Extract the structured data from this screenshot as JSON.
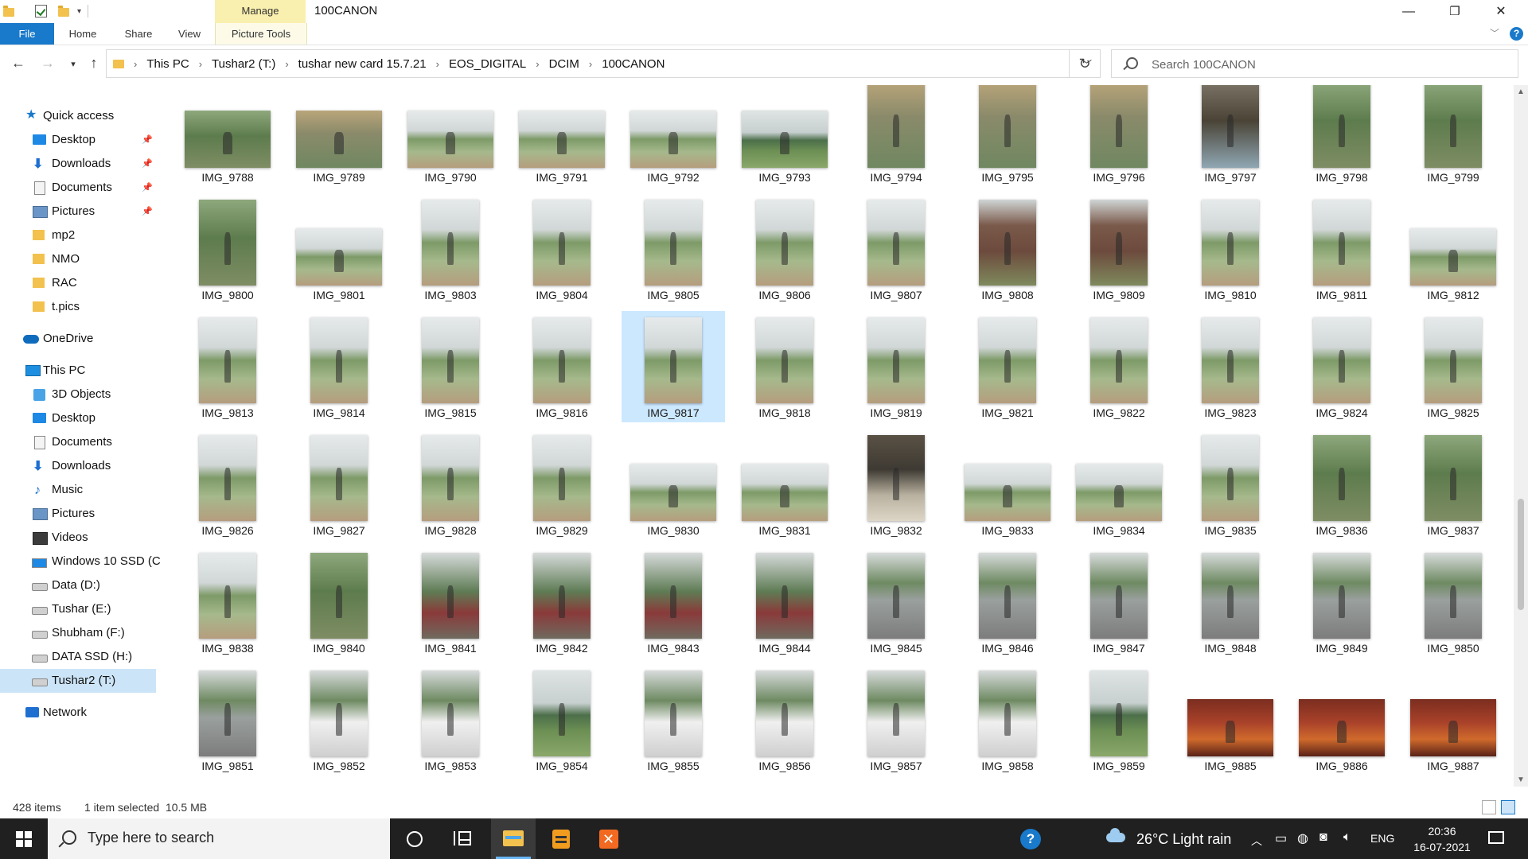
{
  "window": {
    "title": "100CANON",
    "manage_tab": "Manage",
    "picture_tools_tab": "Picture Tools",
    "minimize": "—",
    "maximize": "❐",
    "close": "✕"
  },
  "ribbon": {
    "tabs": [
      "File",
      "Home",
      "Share",
      "View"
    ],
    "help": "?"
  },
  "address": {
    "crumbs": [
      "This PC",
      "Tushar2 (T:)",
      "tushar new card 15.7.21",
      "EOS_DIGITAL",
      "DCIM",
      "100CANON"
    ],
    "search_placeholder": "Search 100CANON"
  },
  "nav": {
    "quick_access": "Quick access",
    "quick_items": [
      "Desktop",
      "Downloads",
      "Documents",
      "Pictures",
      "mp2",
      "NMO",
      "RAC",
      "t.pics"
    ],
    "onedrive": "OneDrive",
    "this_pc": "This PC",
    "pc_items": [
      "3D Objects",
      "Desktop",
      "Documents",
      "Downloads",
      "Music",
      "Pictures",
      "Videos",
      "Windows 10 SSD (C",
      "Data (D:)",
      "Tushar (E:)",
      "Shubham (F:)",
      "DATA SSD (H:)",
      "Tushar2 (T:)"
    ],
    "network": "Network"
  },
  "files": [
    "IMG_9788",
    "IMG_9789",
    "IMG_9790",
    "IMG_9791",
    "IMG_9792",
    "IMG_9793",
    "IMG_9794",
    "IMG_9795",
    "IMG_9796",
    "IMG_9797",
    "IMG_9798",
    "IMG_9799",
    "IMG_9800",
    "IMG_9801",
    "IMG_9803",
    "IMG_9804",
    "IMG_9805",
    "IMG_9806",
    "IMG_9807",
    "IMG_9808",
    "IMG_9809",
    "IMG_9810",
    "IMG_9811",
    "IMG_9812",
    "IMG_9813",
    "IMG_9814",
    "IMG_9815",
    "IMG_9816",
    "IMG_9817",
    "IMG_9818",
    "IMG_9819",
    "IMG_9821",
    "IMG_9822",
    "IMG_9823",
    "IMG_9824",
    "IMG_9825",
    "IMG_9826",
    "IMG_9827",
    "IMG_9828",
    "IMG_9829",
    "IMG_9830",
    "IMG_9831",
    "IMG_9832",
    "IMG_9833",
    "IMG_9834",
    "IMG_9835",
    "IMG_9836",
    "IMG_9837",
    "IMG_9838",
    "IMG_9840",
    "IMG_9841",
    "IMG_9842",
    "IMG_9843",
    "IMG_9844",
    "IMG_9845",
    "IMG_9846",
    "IMG_9847",
    "IMG_9848",
    "IMG_9849",
    "IMG_9850",
    "IMG_9851",
    "IMG_9852",
    "IMG_9853",
    "IMG_9854",
    "IMG_9855",
    "IMG_9856",
    "IMG_9857",
    "IMG_9858",
    "IMG_9859",
    "IMG_9885",
    "IMG_9886",
    "IMG_9887"
  ],
  "selected_file": "IMG_9817",
  "status": {
    "items": "428 items",
    "selection": "1 item selected  10.5 MB"
  },
  "taskbar": {
    "search_placeholder": "Type here to search",
    "weather": "26°C  Light rain",
    "language": "ENG",
    "time": "20:36",
    "date": "16-07-2021"
  },
  "colors": {
    "accent": "#1979ca",
    "manage_tab": "#f9efae",
    "selection": "#cce8ff",
    "taskbar": "#202020"
  }
}
